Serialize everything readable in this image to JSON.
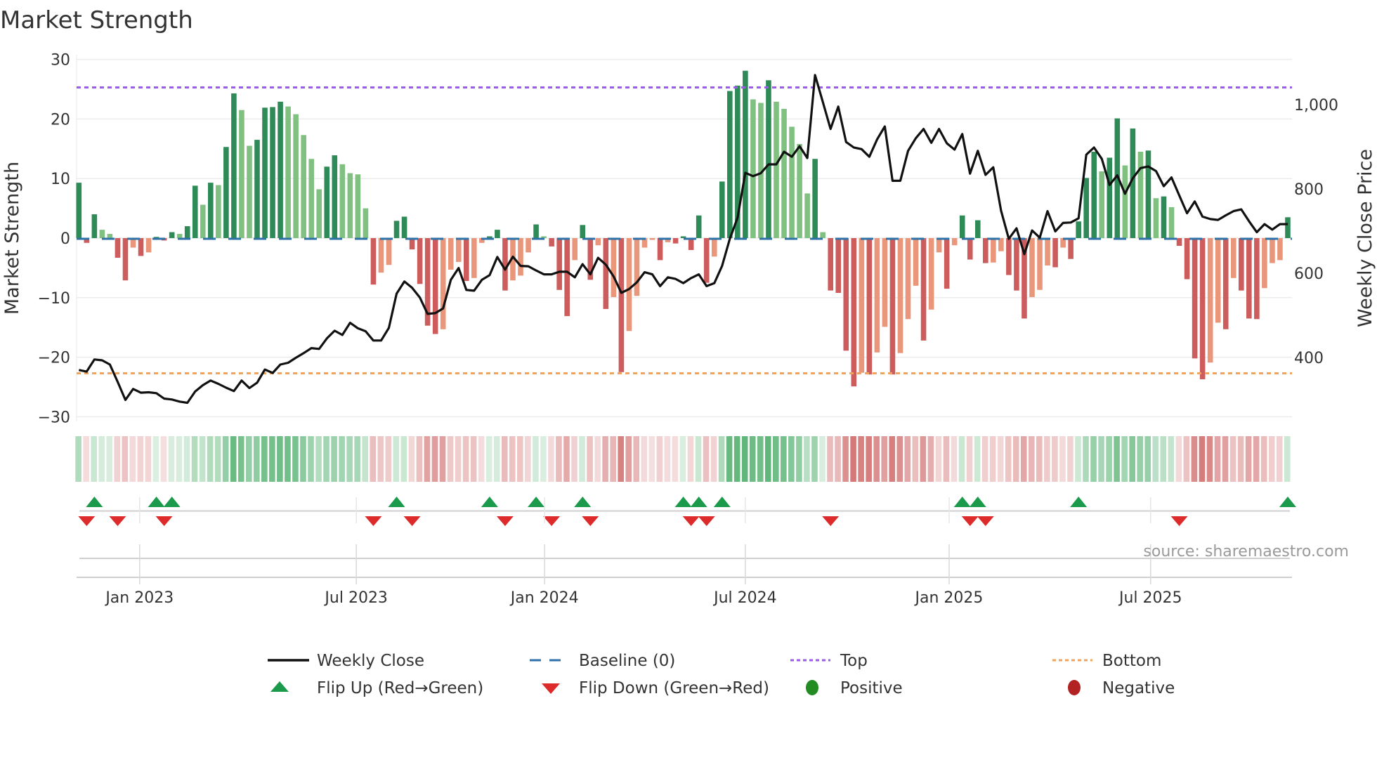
{
  "chart_data": {
    "type": "bar",
    "title": "Market Strength",
    "ylabel": "Market Strength",
    "y2label": "Weekly Close Price",
    "ylim": [
      -30,
      30
    ],
    "y2lim": [
      270,
      1115
    ],
    "yticks": [
      "30",
      "20",
      "10",
      "0",
      "−10",
      "−20",
      "−30"
    ],
    "ytick_values": [
      30,
      20,
      10,
      0,
      -10,
      -20,
      -30
    ],
    "y2ticks": [
      {
        "label": "1,000",
        "value": 1000
      },
      {
        "label": "800",
        "value": 800
      },
      {
        "label": "600",
        "value": 600
      },
      {
        "label": "400",
        "value": 400
      }
    ],
    "x_unit": "week index",
    "xticks": [
      {
        "label": "Jan 2023",
        "x": 7.84
      },
      {
        "label": "Jul 2023",
        "x": 35.8
      },
      {
        "label": "Jan 2024",
        "x": 60.1
      },
      {
        "label": "Jul 2024",
        "x": 86.0
      },
      {
        "label": "Jan 2025",
        "x": 112.3
      },
      {
        "label": "Jul 2025",
        "x": 138.3
      }
    ],
    "top_level": 25.3,
    "bottom_level": -22.7,
    "baseline": 0,
    "grid": true,
    "series": [
      {
        "name": "Market Strength",
        "type": "bar",
        "values": [
          9.3,
          -0.8,
          4.0,
          1.4,
          0.7,
          -3.3,
          -7.1,
          -1.6,
          -3.0,
          -2.4,
          0.2,
          -0.4,
          1.0,
          0.7,
          2.0,
          8.8,
          5.6,
          9.3,
          8.9,
          15.3,
          24.3,
          21.5,
          15.5,
          16.5,
          21.9,
          22.0,
          22.9,
          22.1,
          20.8,
          17.3,
          13.3,
          8.2,
          12.0,
          13.9,
          12.4,
          10.9,
          10.7,
          5.0,
          -7.8,
          -5.8,
          -4.5,
          2.9,
          3.6,
          -1.9,
          -7.7,
          -14.7,
          -16.1,
          -15.3,
          -5.3,
          -4.0,
          -7.2,
          -6.7,
          -0.8,
          0.3,
          1.4,
          -8.8,
          -7.1,
          -6.3,
          -2.4,
          2.3,
          0.3,
          -1.4,
          -8.7,
          -13.1,
          -3.7,
          2.2,
          -7.0,
          -1.2,
          -11.9,
          -9.9,
          -22.5,
          -15.6,
          -9.7,
          -1.6,
          -0.3,
          -3.7,
          -0.7,
          -0.9,
          0.3,
          -2.0,
          3.8,
          -7.5,
          -3.1,
          9.5,
          24.7,
          25.6,
          28.1,
          23.3,
          22.7,
          26.5,
          22.9,
          21.7,
          18.7,
          15.8,
          7.5,
          13.3,
          1.0,
          -8.8,
          -9.2,
          -18.9,
          -24.9,
          -22.6,
          -22.9,
          -19.2,
          -14.9,
          -22.9,
          -19.3,
          -13.6,
          -8.0,
          -17.2,
          -12.0,
          -2.4,
          -8.5,
          -1.2,
          3.8,
          -3.6,
          3.0,
          -4.2,
          -4.1,
          -2.2,
          -6.2,
          -8.8,
          -13.5,
          -9.9,
          -8.7,
          -4.6,
          -4.9,
          -1.6,
          -3.5,
          2.8,
          10.1,
          14.5,
          11.2,
          13.5,
          20.1,
          12.2,
          18.4,
          14.5,
          14.7,
          6.7,
          7.0,
          5.2,
          -1.3,
          -6.9,
          -20.2,
          -23.7,
          -20.9,
          -14.2,
          -15.3,
          -6.7,
          -8.8,
          -13.5,
          -13.6,
          -8.4,
          -4.2,
          -3.7,
          3.5
        ]
      },
      {
        "name": "Weekly Close",
        "type": "line",
        "axis": "right",
        "values": [
          370,
          366,
          395,
          393,
          383,
          342,
          299,
          325,
          316,
          317,
          315,
          302,
          300,
          295,
          292,
          319,
          334,
          345,
          337,
          328,
          320,
          345,
          327,
          340,
          371,
          363,
          383,
          387,
          399,
          410,
          422,
          420,
          445,
          463,
          453,
          482,
          469,
          462,
          440,
          440,
          470,
          551,
          580,
          565,
          542,
          503,
          505,
          516,
          584,
          612,
          560,
          558,
          584,
          595,
          638,
          608,
          639,
          617,
          616,
          606,
          597,
          597,
          603,
          603,
          590,
          621,
          597,
          636,
          620,
          592,
          553,
          562,
          578,
          602,
          597,
          569,
          590,
          586,
          576,
          588,
          597,
          569,
          576,
          617,
          681,
          731,
          838,
          830,
          837,
          858,
          858,
          888,
          876,
          901,
          873,
          1070,
          1006,
          942,
          995,
          911,
          898,
          894,
          876,
          917,
          948,
          819,
          819,
          890,
          920,
          942,
          909,
          942,
          908,
          893,
          930,
          836,
          890,
          833,
          851,
          748,
          681,
          706,
          645,
          701,
          684,
          747,
          699,
          719,
          720,
          730,
          881,
          898,
          871,
          809,
          832,
          788,
          825,
          849,
          853,
          842,
          806,
          827,
          784,
          742,
          770,
          734,
          728,
          726,
          737,
          747,
          751,
          723,
          697,
          716,
          703,
          716,
          716
        ]
      }
    ],
    "flip_up": [
      2,
      10,
      12,
      41,
      53,
      59,
      65,
      78,
      80,
      83,
      114,
      116,
      129,
      156
    ],
    "flip_down": [
      1,
      5,
      11,
      38,
      43,
      55,
      61,
      66,
      79,
      81,
      97,
      115,
      117,
      142
    ],
    "legend": {
      "placement": "bottom",
      "items": [
        {
          "label": "Weekly Close",
          "icon": "line-icon"
        },
        {
          "label": "Baseline (0)",
          "icon": "dashed-line-icon"
        },
        {
          "label": "Top",
          "icon": "dotted-line-icon"
        },
        {
          "label": "Bottom",
          "icon": "dotted-line-icon"
        },
        {
          "label": "Flip Up (Red→Green)",
          "icon": "triangle-up-icon"
        },
        {
          "label": "Flip Down (Green→Red)",
          "icon": "triangle-down-icon"
        },
        {
          "label": "Positive",
          "icon": "circle-icon"
        },
        {
          "label": "Negative",
          "icon": "circle-icon"
        }
      ]
    },
    "source": "source: sharemaestro.com"
  },
  "colors": {
    "pos_rising": "#2e8b57",
    "pos_falling": "#80c080",
    "neg_falling": "#cd5c5c",
    "neg_rising": "#e9967a",
    "baseline": "#2f72a8",
    "top": "#9b5de5",
    "bottom": "#f0a35e",
    "price": "#111111",
    "flip_up": "#1a9a4a",
    "flip_down": "#dd2a2a",
    "positive": "#228b22",
    "negative": "#b22222",
    "grid": "#ececec"
  }
}
